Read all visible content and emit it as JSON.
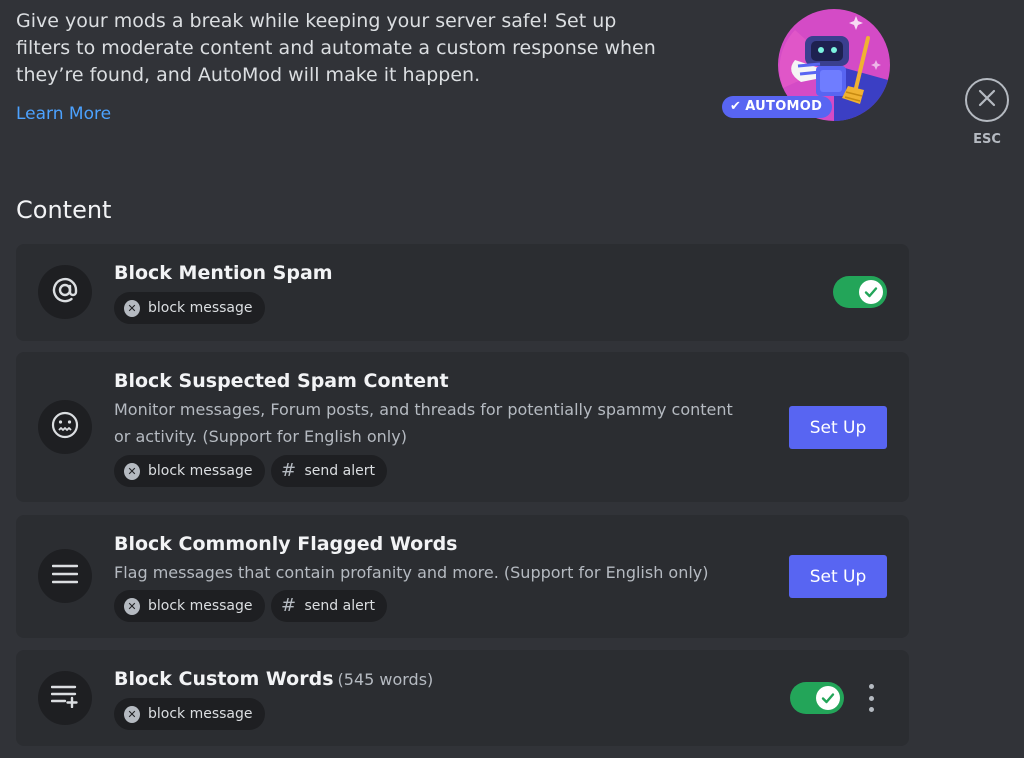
{
  "intro": {
    "text": "Give your mods a break while keeping your server safe! Set up filters to moderate content and automate a custom response when they’re found, and AutoMod will make it happen.",
    "learn_more": "Learn More",
    "badge": "AUTOMOD",
    "badge_icon": "check-icon"
  },
  "close": {
    "label": "ESC",
    "icon": "close-icon"
  },
  "section": {
    "title": "Content"
  },
  "rules": [
    {
      "title": "Block Mention Spam",
      "icon": "at-sign-icon",
      "tags": [
        {
          "label": "block message",
          "icon": "x-circle-icon"
        }
      ],
      "enabled": true
    },
    {
      "title": "Block Suspected Spam Content",
      "icon": "grimace-face-icon",
      "description": "Monitor messages, Forum posts, and threads for potentially spammy content or activity. (Support for English only)",
      "tags": [
        {
          "label": "block message",
          "icon": "x-circle-icon"
        },
        {
          "label": "send alert",
          "icon": "hash-icon"
        }
      ],
      "action": "Set Up"
    },
    {
      "title": "Block Commonly Flagged Words",
      "icon": "lines-icon",
      "description": "Flag messages that contain profanity and more. (Support for English only)",
      "tags": [
        {
          "label": "block message",
          "icon": "x-circle-icon"
        },
        {
          "label": "send alert",
          "icon": "hash-icon"
        }
      ],
      "action": "Set Up"
    },
    {
      "title": "Block Custom Words",
      "count": "(545 words)",
      "icon": "list-add-icon",
      "tags": [
        {
          "label": "block message",
          "icon": "x-circle-icon"
        }
      ],
      "enabled": true
    }
  ],
  "colors": {
    "background": "#313338",
    "card": "#2b2d31",
    "accent": "#5865f2",
    "toggle_on": "#23a559",
    "link": "#4ca2ff"
  }
}
